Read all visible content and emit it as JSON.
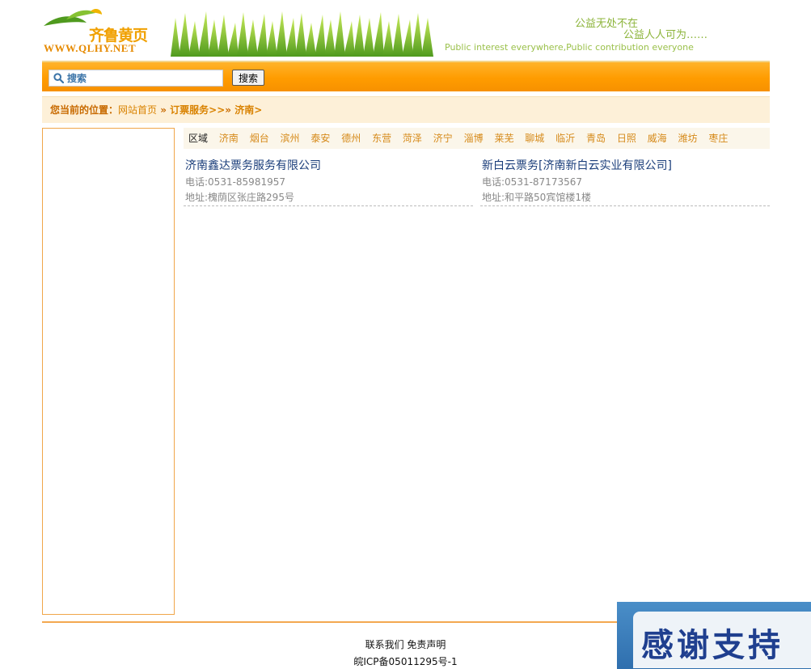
{
  "header": {
    "logo_cn": "齐鲁黄页",
    "logo_url": "WWW.QLHY.NET",
    "slogan_line1": "公益无处不在",
    "slogan_line2": "公益人人可为……",
    "slogan_en": "Public interest everywhere,Public contribution everyone"
  },
  "search": {
    "placeholder": "搜索",
    "button_label": "搜索"
  },
  "breadcrumb": {
    "prefix": "您当前的位置：",
    "home": "网站首页",
    "sep1": " » ",
    "category": "订票服务>>",
    "sep2": "» ",
    "city": "济南>"
  },
  "regions": {
    "label": "区域",
    "items": [
      "济南",
      "烟台",
      "滨州",
      "泰安",
      "德州",
      "东营",
      "菏泽",
      "济宁",
      "淄博",
      "莱芜",
      "聊城",
      "临沂",
      "青岛",
      "日照",
      "威海",
      "潍坊",
      "枣庄"
    ]
  },
  "listings": [
    {
      "name": "济南鑫达票务服务有限公司",
      "phone": "电话:0531-85981957",
      "address": "地址:槐荫区张庄路295号"
    },
    {
      "name": "新白云票务[济南新白云实业有限公司]",
      "phone": "电话:0531-87173567",
      "address": "地址:和平路50宾馆楼1楼"
    }
  ],
  "footer": {
    "contact": "联系我们",
    "disclaimer": "免责声明",
    "icp": "皖ICP备05011295号-1"
  },
  "banner": {
    "text": "感谢支持"
  },
  "colors": {
    "accent_orange": "#ff9c00",
    "breadcrumb_bg": "#fdf0d8",
    "link_orange": "#d68a1a",
    "title_blue": "#1a3d7a"
  }
}
